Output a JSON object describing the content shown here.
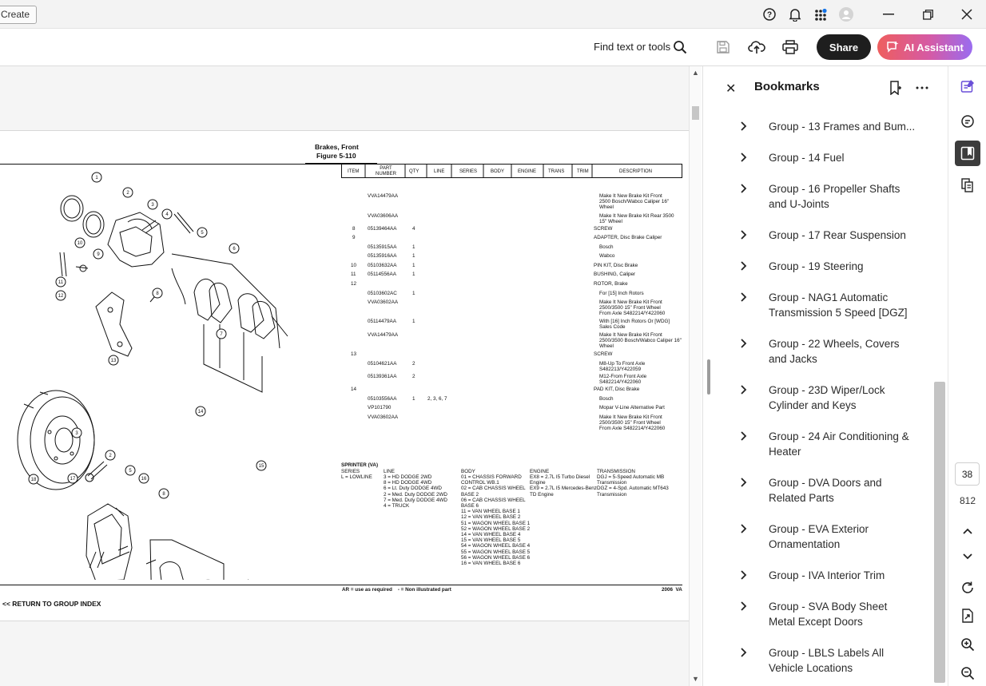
{
  "titlebar": {
    "create_label": "Create"
  },
  "toolbar": {
    "find_label": "Find text or tools",
    "share_label": "Share",
    "ai_label": "AI Assistant"
  },
  "document": {
    "title": "Brakes, Front",
    "figure": "Figure 5-110",
    "headers": [
      "ITEM",
      "PART NUMBER",
      "QTY",
      "LINE",
      "SERIES",
      "BODY",
      "ENGINE",
      "TRANS",
      "TRIM",
      "DESCRIPTION"
    ],
    "rows": [
      {
        "item": "",
        "part": "VVA14479AA",
        "qty": "",
        "line": "",
        "desc": "Make It New Brake Kit Front\n2500 Bosch/Wabco Caliper 16\"\nWheel"
      },
      {
        "item": "",
        "part": "VVA03606AA",
        "qty": "",
        "line": "",
        "desc": "Make It New Brake Kit Rear 3500\n15\" Wheel"
      },
      {
        "item": "8",
        "part": "05139464AA",
        "qty": "4",
        "line": "",
        "desc": "SCREW"
      },
      {
        "item": "9",
        "part": "",
        "qty": "",
        "line": "",
        "desc": "ADAPTER, Disc Brake Caliper"
      },
      {
        "item": "",
        "part": "05135915AA",
        "qty": "1",
        "line": "",
        "desc": "Bosch"
      },
      {
        "item": "",
        "part": "05135916AA",
        "qty": "1",
        "line": "",
        "desc": "Wabco"
      },
      {
        "item": "10",
        "part": "05103632AA",
        "qty": "1",
        "line": "",
        "desc": "PIN KIT, Disc Brake"
      },
      {
        "item": "11",
        "part": "05114556AA",
        "qty": "1",
        "line": "",
        "desc": "BUSHING, Caliper"
      },
      {
        "item": "12",
        "part": "",
        "qty": "",
        "line": "",
        "desc": "ROTOR, Brake"
      },
      {
        "item": "",
        "part": "05103602AC",
        "qty": "1",
        "line": "",
        "desc": "For [15] Inch Rotors"
      },
      {
        "item": "",
        "part": "VVA03602AA",
        "qty": "",
        "line": "",
        "desc": "Make It New Brake Kit Front\n2500/3500 15\" Front Wheel\nFrom Axle S482214/Y422060"
      },
      {
        "item": "",
        "part": "05114479AA",
        "qty": "1",
        "line": "",
        "desc": "With [16] Inch Rotors Or [WDG]\nSales Code"
      },
      {
        "item": "",
        "part": "VVA14479AA",
        "qty": "",
        "line": "",
        "desc": "Make It New Brake Kit Front\n2500/3500 Bosch/Wabco Caliper 16\"\nWheel"
      },
      {
        "item": "13",
        "part": "",
        "qty": "",
        "line": "",
        "desc": "SCREW"
      },
      {
        "item": "",
        "part": "05104621AA",
        "qty": "2",
        "line": "",
        "desc": "M8-Up To Front Axle\nS482213/Y422059"
      },
      {
        "item": "",
        "part": "05139361AA",
        "qty": "2",
        "line": "",
        "desc": "M12-From Front Axle\nS482214/Y422060"
      },
      {
        "item": "14",
        "part": "",
        "qty": "",
        "line": "",
        "desc": "PAD KIT, Disc Brake"
      },
      {
        "item": "",
        "part": "05103556AA",
        "qty": "1",
        "line": "2, 3, 6, 7",
        "desc": "Bosch"
      },
      {
        "item": "",
        "part": "VP101790",
        "qty": "",
        "line": "",
        "desc": "Mopar V-Line Alternative Part"
      },
      {
        "item": "",
        "part": "VVA03602AA",
        "qty": "",
        "line": "",
        "desc": "Make It New Brake Kit Front\n2500/3500 15\" Front Wheel\nFrom Axle S482214/Y422060"
      }
    ],
    "legend": {
      "heading": "SPRINTER (VA)",
      "series_label": "SERIES",
      "series_value": "L = LOWLINE",
      "line_label": "LINE",
      "line_value": "3 = HD DODGE 2WD\n8 = HD DODGE 4WD\n6 = Lt. Duty DODGE 4WD\n2 = Med. Duty DODGE 2WD\n7 = Med. Duty DODGE 4WD\n4 = TRUCK",
      "body_label": "BODY",
      "body_value": "01 = CHASSIS FORWARD\nCONTROL WB.1\n02 = CAB CHASSIS WHEEL\nBASE 2\n06 = CAB CHASSIS WHEEL\nBASE 6\n11 = VAN WHEEL BASE 1\n12 = VAN WHEEL BASE 2\n51 = WAGON WHEEL BASE 1\n52 = WAGON WHEEL BASE 2\n14 = VAN WHEEL BASE 4\n15 = VAN WHEEL BASE 5\n54 = WAGON WHEEL BASE 4\n55 = WAGON WHEEL BASE 5\n56 = WAGON WHEEL BASE 6\n16 = VAN WHEEL BASE 6",
      "engine_label": "ENGINE",
      "engine_value": "EX8 = 2.7L I5 Turbo Diesel\nEngine\nEX9 = 2.7L I5 Mercedes-Benz\nTD Engine",
      "trans_label": "TRANSMISSION",
      "trans_value": "DGJ = 5-Speed Automatic MB\nTransmission\nDGZ = 4-Spd. Automatic MT643\nTransmission"
    },
    "footer_note": "AR = use as required    - = Non illustrated part",
    "footer_right": "2006  VA",
    "return_link": "<< RETURN TO GROUP INDEX",
    "callouts": [
      "1",
      "2",
      "3",
      "4",
      "5",
      "6",
      "7",
      "8",
      "9",
      "10",
      "11",
      "12",
      "13",
      "14",
      "15",
      "16",
      "17",
      "18",
      "2",
      "3",
      "5",
      "8"
    ]
  },
  "bookmarks": {
    "title": "Bookmarks",
    "items": [
      "Group - 13 Frames and Bum...",
      "Group - 14 Fuel",
      "Group - 16 Propeller Shafts and U-Joints",
      "Group - 17 Rear Suspension",
      "Group - 19 Steering",
      "Group - NAG1 Automatic Transmission 5 Speed [DGZ]",
      "Group - 22 Wheels, Covers and Jacks",
      "Group - 23D Wiper/Lock Cylinder and Keys",
      "Group - 24 Air Conditioning & Heater",
      "Group - DVA Doors and Related Parts",
      "Group - EVA Exterior Ornamentation",
      "Group - IVA Interior Trim",
      "Group - SVA Body Sheet Metal Except Doors",
      "Group - LBLS Labels All Vehicle Locations"
    ]
  },
  "rail": {
    "current_page": "38",
    "total_pages": "812"
  }
}
